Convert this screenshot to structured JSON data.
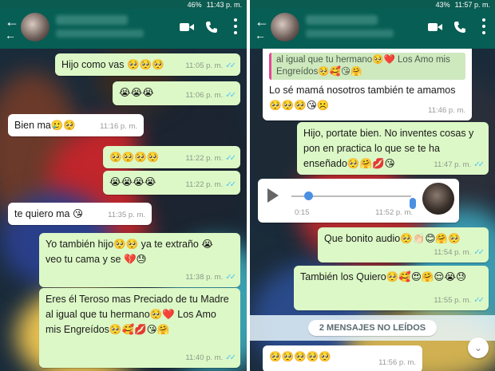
{
  "left": {
    "status": {
      "battery": "46%",
      "time": "11:43 p. m."
    },
    "messages": [
      {
        "dir": "out",
        "text": "Hijo como vas 🥺🥺🥺",
        "time": "11:05 p. m.",
        "ticks": "✓✓"
      },
      {
        "dir": "out",
        "text": "😭😭😭",
        "time": "11:06 p. m.",
        "ticks": "✓✓"
      },
      {
        "dir": "in",
        "text": "Bien ma🥲🥺",
        "time": "11:16 p. m."
      },
      {
        "dir": "out",
        "text": "🥺🥺🥺🥺",
        "time": "11:22 p. m.",
        "ticks": "✓✓"
      },
      {
        "dir": "out",
        "text": "😭😭😭😭",
        "time": "11:22 p. m.",
        "ticks": "✓✓"
      },
      {
        "dir": "in",
        "text": "te quiero ma 😘",
        "time": "11:35 p. m."
      },
      {
        "dir": "out",
        "text": "Yo también hijo🥺🥺 ya te extraño 😭 veo tu cama y se 💔😓",
        "time": "11:38 p. m.",
        "ticks": "✓✓"
      },
      {
        "dir": "out",
        "text": "Eres él Teroso mas Preciado de tu Madre al igual que tu hermano🥺❤️ Los Amo mis Engreídos🥺🥰💋😘🤗",
        "time": "11:40 p. m.",
        "ticks": "✓✓"
      }
    ]
  },
  "right": {
    "status": {
      "battery": "43%",
      "time": "11:57 p. m."
    },
    "quoted": "al igual que tu hermano🥺❤️ Los Amo mis Engreídos🥺🥰😘🤗",
    "reply": {
      "text": "Lo sé mamá nosotros también te amamos 🥺🥺🥺😘☹️",
      "time": "11:46 p. m."
    },
    "messages": [
      {
        "dir": "out",
        "text": "Hijo, portate bien. No inventes cosas y pon en practica lo que se te ha enseñado🥺🤗💋😘",
        "time": "11:47 p. m.",
        "ticks": "✓✓"
      }
    ],
    "voice": {
      "duration": "0:15",
      "time": "11:52 p. m."
    },
    "messages2": [
      {
        "dir": "out",
        "text": "Que bonito audio🥺👏🏻😊🤗🥺",
        "time": "11:54 p. m.",
        "ticks": "✓✓"
      },
      {
        "dir": "out",
        "text": "También los Quiero🥺🥰😍🤗😌😭😓",
        "time": "11:55 p. m.",
        "ticks": "✓✓"
      }
    ],
    "unread_label": "2 MENSAJES NO LEÍDOS",
    "last": {
      "text": "🥺🥺🥺🥺🥺",
      "time": "11:56 p. m."
    }
  }
}
